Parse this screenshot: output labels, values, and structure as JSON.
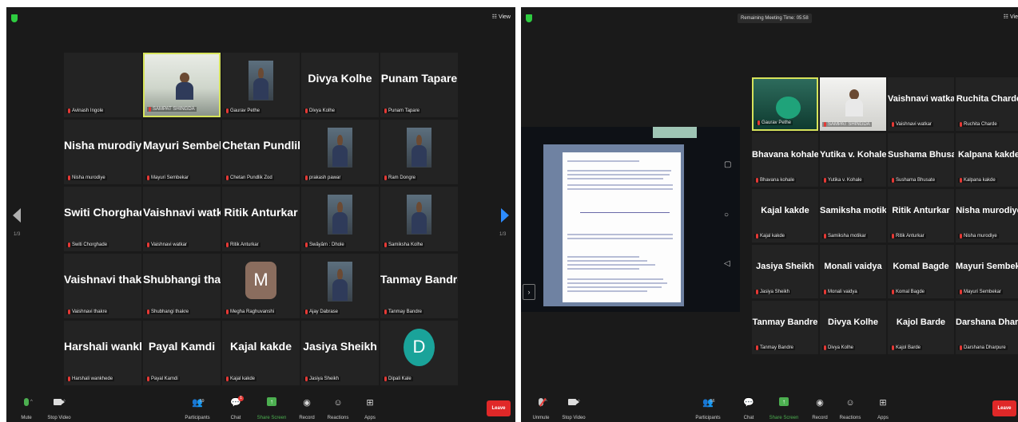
{
  "left": {
    "view_label": "☷ View",
    "page_count": "1/3",
    "tiles": [
      {
        "big": "",
        "label": "Avinash Ingole"
      },
      {
        "big": "",
        "label": "SAMPAT SHINGDA"
      },
      {
        "big": "",
        "label": "Gaurav Pethe"
      },
      {
        "big": "Divya Kolhe",
        "label": "Divya Kolhe"
      },
      {
        "big": "Punam Tapare",
        "label": "Punam Tapare"
      },
      {
        "big": "Nisha murodiye",
        "label": "Nisha murodiye"
      },
      {
        "big": "Mayuri Sembekar",
        "label": "Mayuri Sembekar"
      },
      {
        "big": "Chetan Pundlik...",
        "label": "Chetan Pundlik Zod"
      },
      {
        "big": "",
        "label": "prakash pawar"
      },
      {
        "big": "",
        "label": "Ram Dongre"
      },
      {
        "big": "Switi Chorghade",
        "label": "Switi Chorghade"
      },
      {
        "big": "Vaishnavi watkar",
        "label": "Vaishnavi watkar"
      },
      {
        "big": "Ritik Anturkar",
        "label": "Ritik Anturkar"
      },
      {
        "big": "",
        "label": "Swâyâm : Dhole"
      },
      {
        "big": "",
        "label": "Samiksha Kolhe"
      },
      {
        "big": "Vaishnavi thakre",
        "label": "Vaishnavi thakre"
      },
      {
        "big": "Shubhangi thakre",
        "label": "Shubhangi thakre"
      },
      {
        "big": "M",
        "label": "Megha Raghuvanshi"
      },
      {
        "big": "",
        "label": "Ajay Dabrase"
      },
      {
        "big": "Tanmay Bandre",
        "label": "Tanmay Bandre"
      },
      {
        "big": "Harshali wankh...",
        "label": "Harshali wankhede"
      },
      {
        "big": "Payal Kamdi",
        "label": "Payal Kamdi"
      },
      {
        "big": "Kajal kakde",
        "label": "Kajal kakde"
      },
      {
        "big": "Jasiya Sheikh",
        "label": "Jasiya Sheikh"
      },
      {
        "big": "D",
        "label": "Dipali Kale"
      }
    ],
    "toolbar": {
      "mute": "Mute",
      "stop_video": "Stop Video",
      "participants": "Participants",
      "participants_count": "59",
      "chat": "Chat",
      "chat_badge": "1",
      "share_screen": "Share Screen",
      "record": "Record",
      "reactions": "Reactions",
      "apps": "Apps",
      "leave": "Leave"
    }
  },
  "right": {
    "view_label": "☷ Vie",
    "remaining_time": "Remaining Meeting Time: 05:58",
    "page_count": "1/3",
    "tiles": [
      {
        "big": "",
        "label": "Gaurav Pethe"
      },
      {
        "big": "",
        "label": "SAMPAT SHINGDA"
      },
      {
        "big": "Vaishnavi watkar",
        "label": "Vaishnavi watkar"
      },
      {
        "big": "Ruchita Charde",
        "label": "Ruchita Charde"
      },
      {
        "big": "Bhavana kohale",
        "label": "Bhavana kohale"
      },
      {
        "big": "Yutika v. Kohale",
        "label": "Yutika v. Kohale"
      },
      {
        "big": "Sushama Bhusate",
        "label": "Sushama Bhusate"
      },
      {
        "big": "Kalpana kakde",
        "label": "Kalpana kakde"
      },
      {
        "big": "Kajal  kakde",
        "label": "Kajal  kakde"
      },
      {
        "big": "Samiksha motikar",
        "label": "Samiksha motikar"
      },
      {
        "big": "Ritik Anturkar",
        "label": "Ritik Anturkar"
      },
      {
        "big": "Nisha murodiye",
        "label": "Nisha murodiye"
      },
      {
        "big": "Jasiya Sheikh",
        "label": "Jasiya Sheikh"
      },
      {
        "big": "Monali vaidya",
        "label": "Monali vaidya"
      },
      {
        "big": "Komal Bagde",
        "label": "Komal Bagde"
      },
      {
        "big": "Mayuri Sembekar",
        "label": "Mayuri Sembekar"
      },
      {
        "big": "Tanmay Bandre",
        "label": "Tanmay Bandre"
      },
      {
        "big": "Divya Kolhe",
        "label": "Divya Kolhe"
      },
      {
        "big": "Kajol Barde",
        "label": "Kajol Barde"
      },
      {
        "big": "Darshana  Dhar...",
        "label": "Darshana Dharpure"
      }
    ],
    "toolbar": {
      "unmute": "Unmute",
      "stop_video": "Stop Video",
      "participants": "Participants",
      "participants_count": "56",
      "chat": "Chat",
      "share_screen": "Share Screen",
      "record": "Record",
      "reactions": "Reactions",
      "apps": "Apps",
      "leave": "Leave"
    }
  },
  "colors": {
    "window_bg": "#1a1a1a",
    "tile_bg": "#232323",
    "active_speaker": "#d6e35b",
    "leave": "#e02828",
    "share_green": "#4caf50",
    "nav_blue": "#2d8cff"
  }
}
